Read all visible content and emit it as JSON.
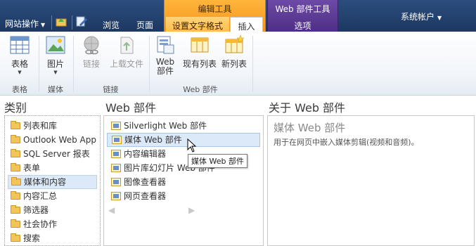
{
  "topbar": {
    "site_actions": "网站操作",
    "tabs": {
      "browse": "浏览",
      "page": "页面"
    },
    "contextual_edit": {
      "title": "编辑工具",
      "format_text": "设置文字格式",
      "insert": "插入"
    },
    "contextual_web": {
      "title": "Web 部件工具",
      "options": "选项"
    },
    "account": "系统帐户"
  },
  "ribbon": {
    "table": {
      "button": "表格",
      "group": "表格"
    },
    "media": {
      "button": "图片",
      "group": "媒体"
    },
    "links": {
      "link": "链接",
      "upload": "上载文件",
      "group": "链接"
    },
    "webparts": {
      "web_part_line1": "Web",
      "web_part_line2": "部件",
      "existing_list": "现有列表",
      "new_list": "新列表",
      "group": "Web 部件"
    }
  },
  "categories": {
    "title": "类别",
    "items": [
      "列表和库",
      "Outlook Web App",
      "SQL Server 报表",
      "表单",
      "媒体和内容",
      "内容汇总",
      "筛选器",
      "社会协作",
      "搜索"
    ]
  },
  "webparts_panel": {
    "title": "Web 部件",
    "items": [
      "Silverlight Web 部件",
      "媒体 Web 部件",
      "内容编辑器",
      "图片库幻灯片 Web 部件",
      "图像查看器",
      "网页查看器"
    ]
  },
  "about": {
    "title": "关于 Web 部件",
    "part_title": "媒体 Web 部件",
    "description": "用于在网页中嵌入媒体剪辑(视频和音频)。"
  },
  "tooltip": "媒体 Web 部件",
  "colors": {
    "topbar": "#22406a",
    "edit_context": "#f7941d",
    "web_context": "#4e2f85",
    "selection": "#dbe9f8"
  }
}
